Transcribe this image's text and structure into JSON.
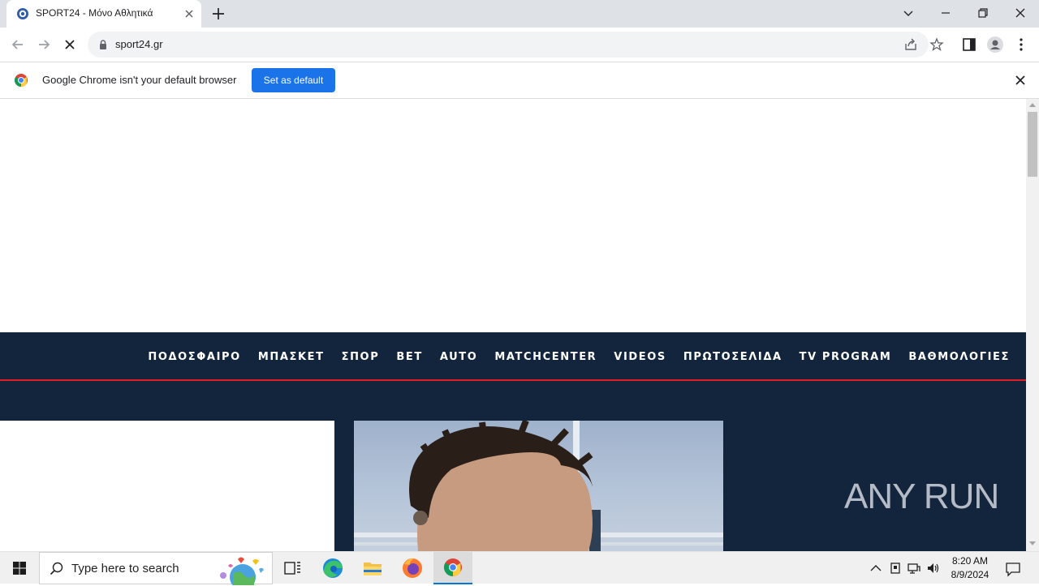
{
  "browser": {
    "tab_title": "SPORT24 - Μόνο Αθλητικά",
    "url": "sport24.gr",
    "infobar_text": "Google Chrome isn't your default browser",
    "infobar_button": "Set as default"
  },
  "site": {
    "nav_items": [
      "ΠΟΔΟΣΦΑΙΡΟ",
      "ΜΠΑΣΚΕΤ",
      "ΣΠΟΡ",
      "BET",
      "AUTO",
      "MATCHCENTER",
      "VIDEOS",
      "ΠΡΩΤΟΣΕΛΙΔΑ",
      "TV PROGRAM",
      "ΒΑΘΜΟΛΟΓΙΕΣ"
    ],
    "nav_bg_color": "#13253c",
    "nav_accent_color": "#e31e24"
  },
  "watermark": "ANY RUN",
  "taskbar": {
    "search_placeholder": "Type here to search",
    "time": "8:20 AM",
    "date": "8/9/2024"
  }
}
